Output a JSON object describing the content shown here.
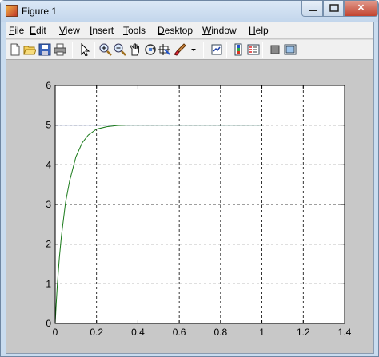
{
  "window": {
    "title": "Figure 1",
    "close_glyph": "✕"
  },
  "menu": [
    {
      "label": "File",
      "accel": "F",
      "rest": "ile"
    },
    {
      "label": "Edit",
      "accel": "E",
      "rest": "dit"
    },
    {
      "label": "View",
      "accel": "V",
      "rest": "iew"
    },
    {
      "label": "Insert",
      "accel": "I",
      "rest": "nsert"
    },
    {
      "label": "Tools",
      "accel": "T",
      "rest": "ools"
    },
    {
      "label": "Desktop",
      "accel": "D",
      "rest": "esktop"
    },
    {
      "label": "Window",
      "accel": "W",
      "rest": "indow"
    },
    {
      "label": "Help",
      "accel": "H",
      "rest": "elp"
    }
  ],
  "toolbar_icons": [
    "new-figure-icon",
    "open-file-icon",
    "save-icon",
    "print-icon",
    "edit-plot-arrow-icon",
    "zoom-in-icon",
    "zoom-out-icon",
    "pan-hand-icon",
    "rotate-3d-icon",
    "data-cursor-icon",
    "brush-icon",
    "brush-dropdown-icon",
    "link-plot-icon",
    "insert-colorbar-icon",
    "insert-legend-icon",
    "hide-plot-tools-icon",
    "show-plot-tools-icon"
  ],
  "chart_data": {
    "type": "line",
    "title": "",
    "xlabel": "",
    "ylabel": "",
    "xlim": [
      0,
      1.4
    ],
    "ylim": [
      0,
      6
    ],
    "xticks": [
      "0",
      "0.2",
      "0.4",
      "0.6",
      "0.8",
      "1",
      "1.2",
      "1.4"
    ],
    "yticks": [
      "0",
      "1",
      "2",
      "3",
      "4",
      "5",
      "6"
    ],
    "grid": true,
    "series": [
      {
        "color": "#1f3a8f",
        "x": [
          0,
          1
        ],
        "y": [
          5,
          5
        ]
      },
      {
        "color": "#1a7a1a",
        "x": [
          0,
          0.005,
          0.01,
          0.02,
          0.03,
          0.05,
          0.07,
          0.1,
          0.13,
          0.16,
          0.2,
          0.25,
          0.3,
          0.35,
          0.4,
          0.5,
          0.6,
          0.8,
          1.0
        ],
        "y": [
          0,
          0.5,
          0.95,
          1.65,
          2.2,
          3.05,
          3.6,
          4.2,
          4.55,
          4.75,
          4.9,
          4.96,
          4.99,
          5,
          5,
          5,
          5,
          5,
          5
        ]
      }
    ]
  }
}
